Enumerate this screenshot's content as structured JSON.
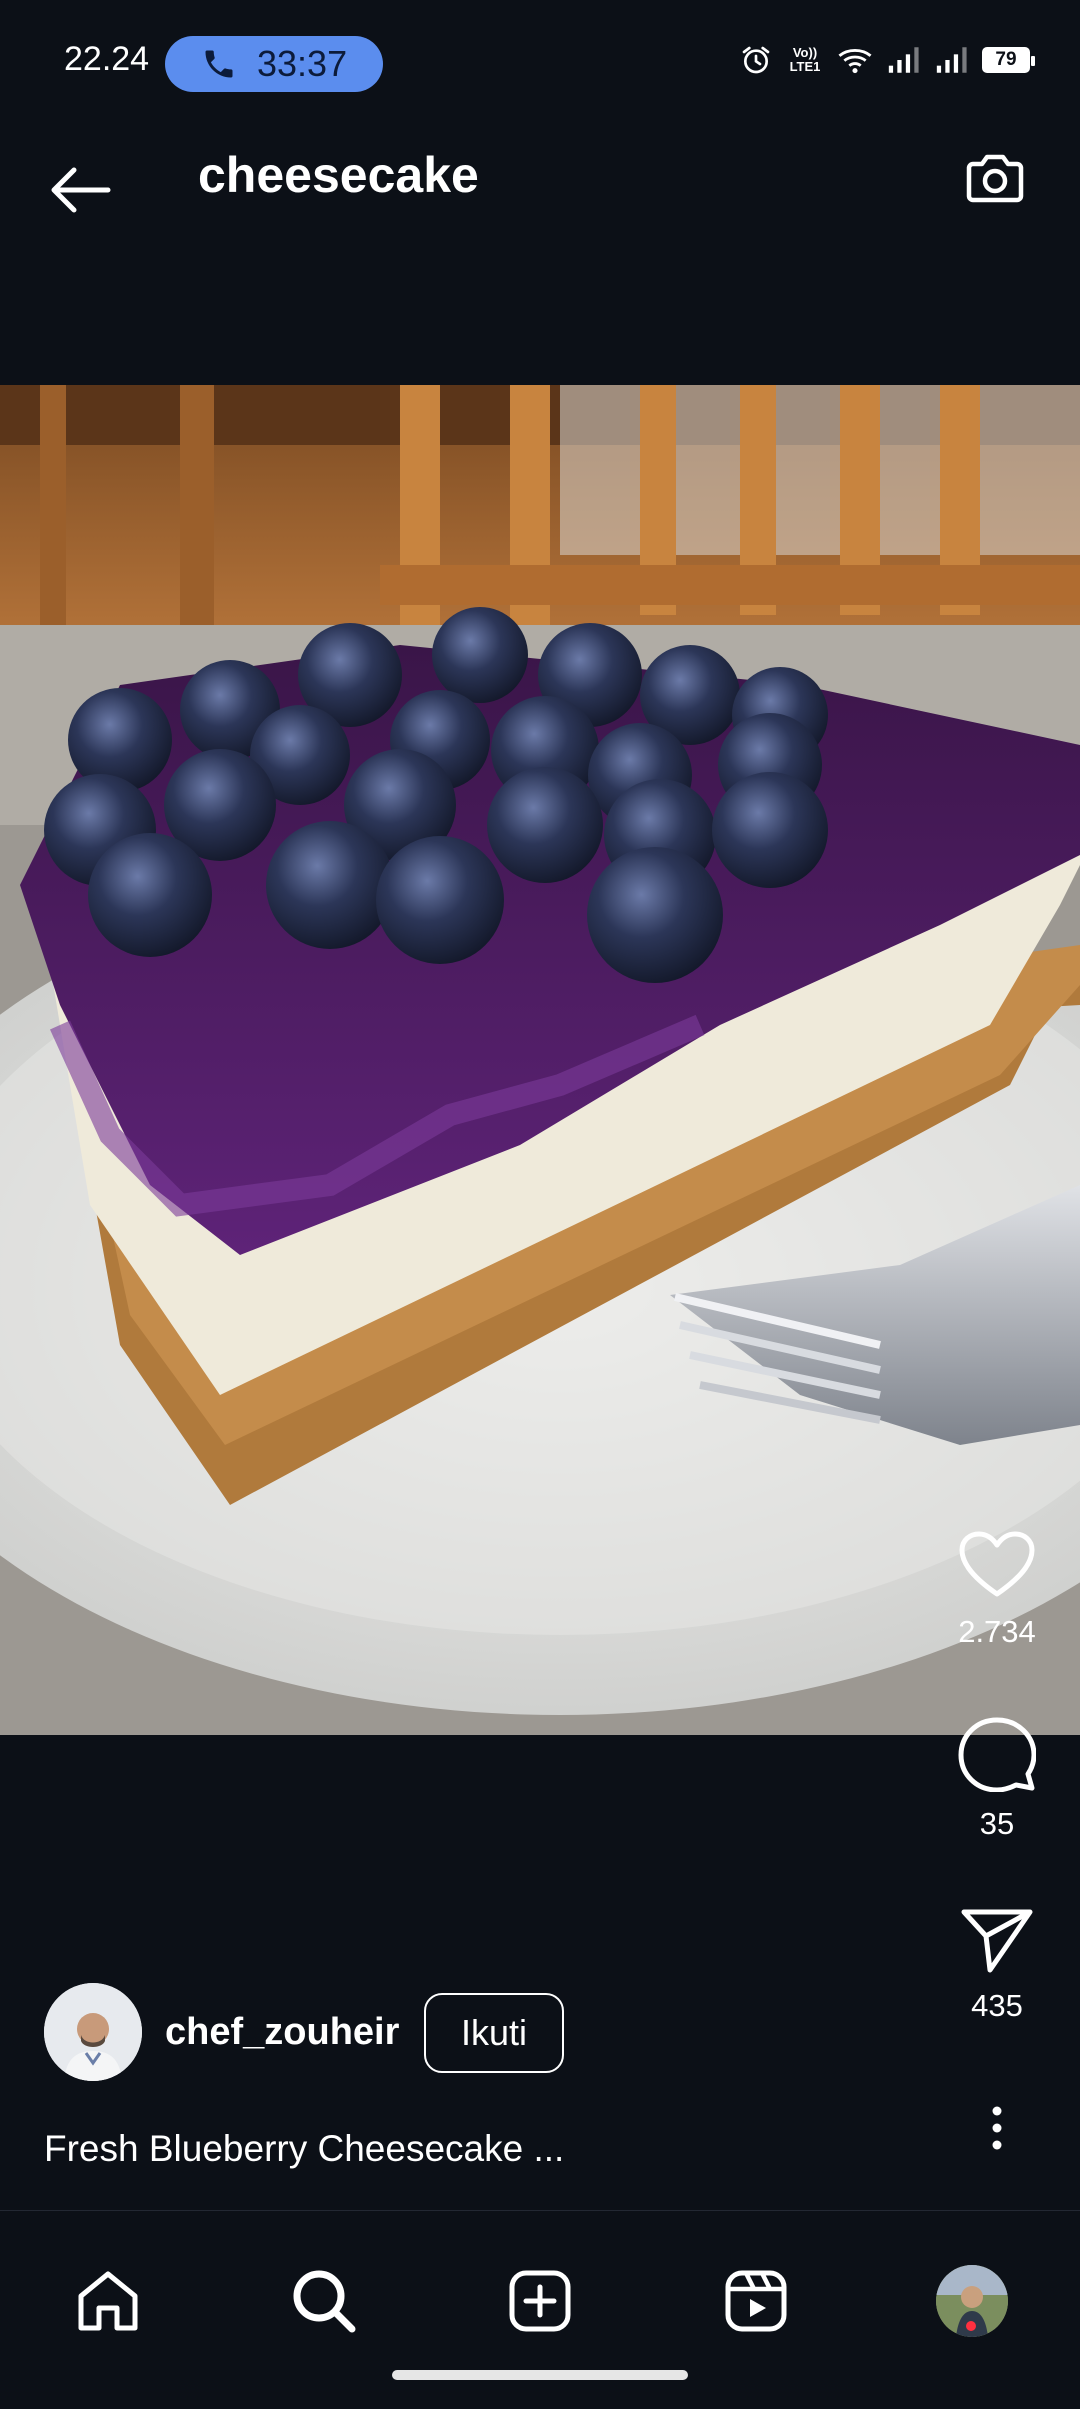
{
  "status_bar": {
    "time": "22.24",
    "call_duration": "33:37",
    "network_label": "Vo)) LTE1",
    "battery": "79"
  },
  "header": {
    "title": "cheesecake",
    "back_icon": "arrow-left-icon",
    "camera_icon": "camera-icon"
  },
  "post": {
    "image_icon": "cheesecake-photo",
    "likes": "2.734",
    "comments": "35",
    "shares": "435",
    "username": "chef_zouheir",
    "follow_label": "Ikuti",
    "caption": "Fresh Blueberry Cheesecake ..."
  },
  "nav": {
    "items": [
      "home-icon",
      "search-icon",
      "create-icon",
      "reels-icon",
      "profile-avatar"
    ]
  },
  "colors": {
    "background": "#0c1017",
    "call_pill": "#5b8dee",
    "notification_dot": "#ff3040"
  }
}
